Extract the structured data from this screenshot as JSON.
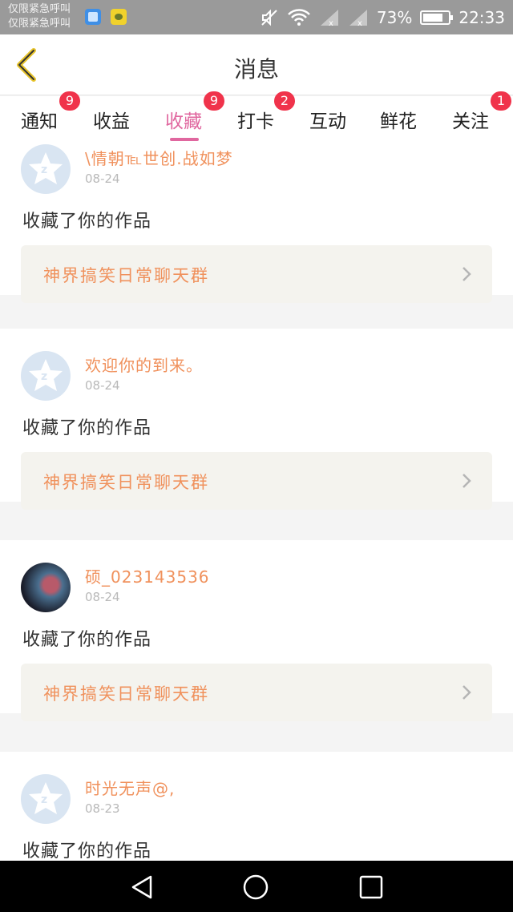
{
  "status_bar": {
    "carrier_line1": "仅限紧急呼叫",
    "carrier_line2": "仅限紧急呼叫",
    "battery": "73%",
    "time": "22:33"
  },
  "header": {
    "title": "消息",
    "back_icon": "chevron-left-icon"
  },
  "tabs": [
    {
      "label": "通知",
      "badge": "9",
      "active": false
    },
    {
      "label": "收益",
      "badge": "",
      "active": false
    },
    {
      "label": "收藏",
      "badge": "9",
      "active": true
    },
    {
      "label": "打卡",
      "badge": "2",
      "active": false
    },
    {
      "label": "互动",
      "badge": "",
      "active": false
    },
    {
      "label": "鲜花",
      "badge": "",
      "active": false
    },
    {
      "label": "关注",
      "badge": "1",
      "active": false
    }
  ],
  "items": [
    {
      "user": "\\情朝℡世创.战如梦",
      "date": "08-24",
      "action": "收藏了你的作品",
      "work": "神界搞笑日常聊天群",
      "avatar": "default-avatar"
    },
    {
      "user": "欢迎你的到来。",
      "date": "08-24",
      "action": "收藏了你的作品",
      "work": "神界搞笑日常聊天群",
      "avatar": "default-avatar"
    },
    {
      "user": "硕_023143536",
      "date": "08-24",
      "action": "收藏了你的作品",
      "work": "神界搞笑日常聊天群",
      "avatar": "photo-avatar"
    },
    {
      "user": "时光无声@,",
      "date": "08-23",
      "action": "收藏了你的作品",
      "work": "",
      "avatar": "default-avatar"
    }
  ],
  "colors": {
    "accent": "#e0679f",
    "name": "#f0915c",
    "badge": "#f0334b"
  }
}
